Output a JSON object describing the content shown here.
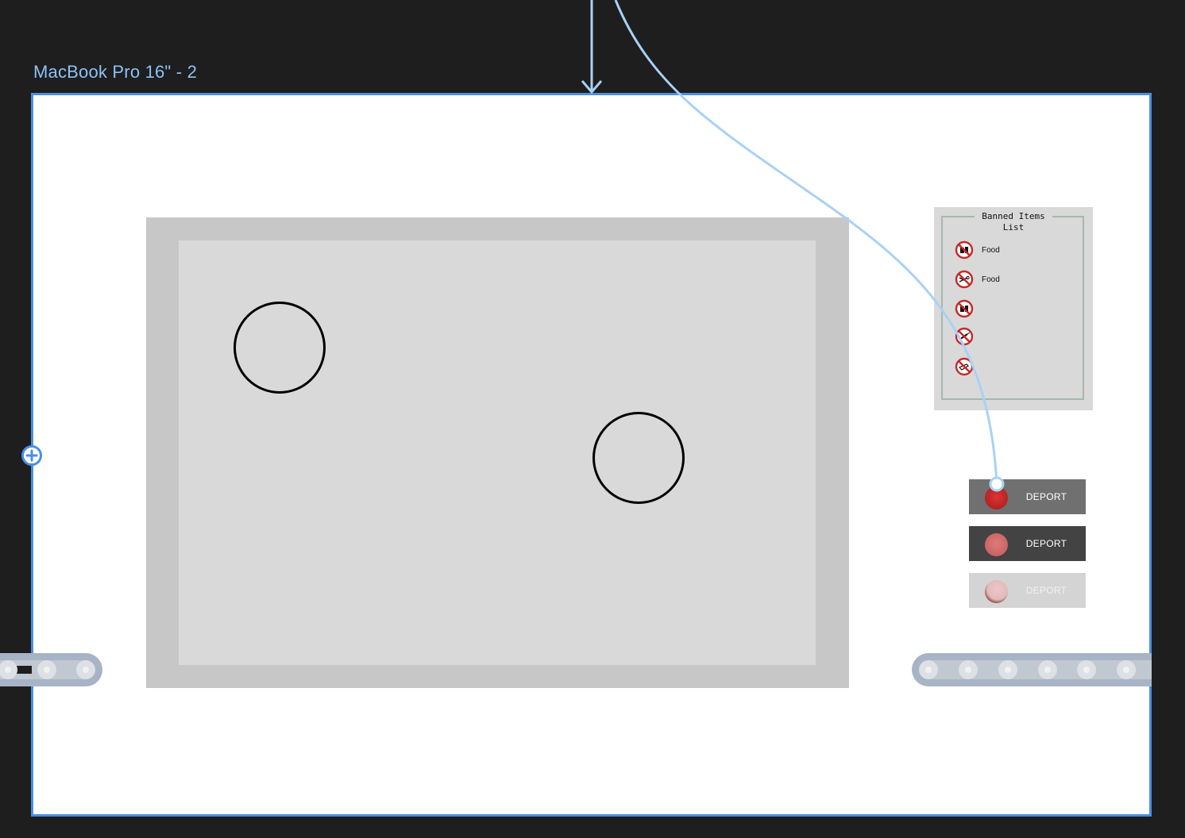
{
  "canvas": {
    "frame_title": "MacBook Pro 16\" - 2",
    "background_color": "#1e1e1e",
    "selection_color": "#4a8fe0",
    "connector_color": "#a9d1f5",
    "add_icon": "plus-icon"
  },
  "game_screen": {
    "outer_color": "#c7c7c7",
    "inner_color": "#d9d9d9",
    "circles": [
      "outline-circle",
      "outline-circle"
    ]
  },
  "banned_items": {
    "title": "Banned Items\nList",
    "items": [
      {
        "icon": "no-fast-food-icon",
        "label": "Food"
      },
      {
        "icon": "no-scissors-icon",
        "label": "Food"
      },
      {
        "icon": "no-fast-food-icon",
        "label": ""
      },
      {
        "icon": "no-syringe-icon",
        "label": ""
      },
      {
        "icon": "no-gun-icon",
        "label": ""
      }
    ]
  },
  "deport_buttons": [
    {
      "label": "DEPORT",
      "state": "default",
      "background": "#707070",
      "knob_color": "#c72b2b",
      "text_color": "#ffffff"
    },
    {
      "label": "DEPORT",
      "state": "hover",
      "background": "#434343",
      "knob_color": "#d46a6a",
      "text_color": "#ffffff"
    },
    {
      "label": "DEPORT",
      "state": "disabled",
      "background": "#d4d4d4",
      "knob_color": "#e8c0c0",
      "text_color": "#ffffff"
    }
  ],
  "conveyors": {
    "left_rollers": 3,
    "right_rollers": 6,
    "belt_color": "#a7b4c5",
    "roller_color": "#dde0e4"
  }
}
